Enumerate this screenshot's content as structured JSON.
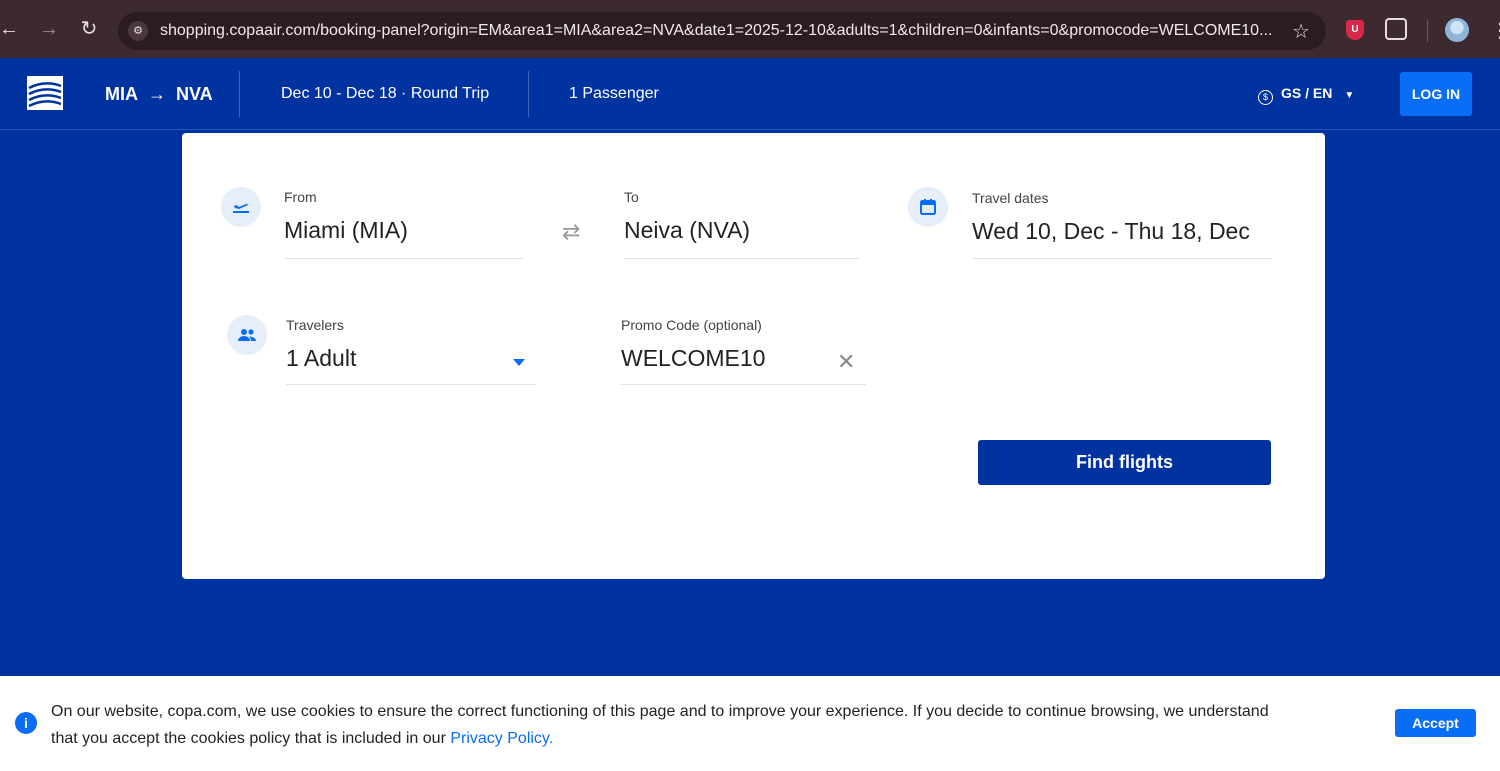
{
  "browser": {
    "url": "shopping.copaair.com/booking-panel?origin=EM&area1=MIA&area2=NVA&date1=2025-12-10&adults=1&children=0&infants=0&promocode=WELCOME10...",
    "back_icon": "←",
    "forward_icon": "→",
    "reload_icon": "↻",
    "star_icon": "☆",
    "extension_badge": "U",
    "menu_icon": "⋮"
  },
  "header": {
    "origin": "MIA",
    "destination": "NVA",
    "route_arrow": "→",
    "dates_summary": "Dec 10 - Dec 18 · Round Trip",
    "passengers_summary": "1 Passenger",
    "locale": "GS / EN",
    "login_label": "LOG IN"
  },
  "booking": {
    "from_label": "From",
    "from_value": "Miami (MIA)",
    "to_label": "To",
    "to_value": "Neiva (NVA)",
    "dates_label": "Travel dates",
    "dates_value": "Wed 10, Dec - Thu 18, Dec",
    "travelers_label": "Travelers",
    "travelers_value": "1 Adult",
    "promo_label": "Promo Code (optional)",
    "promo_value": "WELCOME10",
    "find_flights_label": "Find flights"
  },
  "cookie_banner": {
    "message": "On our website, copa.com, we use cookies to ensure the correct functioning of this page and to improve your experience. If you decide to continue browsing, we understand that you accept the cookies policy that is included in our ",
    "link_text": "Privacy Policy.",
    "accept_label": "Accept"
  },
  "colors": {
    "brand_blue": "#0032a0",
    "accent_blue": "#0a6df5"
  }
}
